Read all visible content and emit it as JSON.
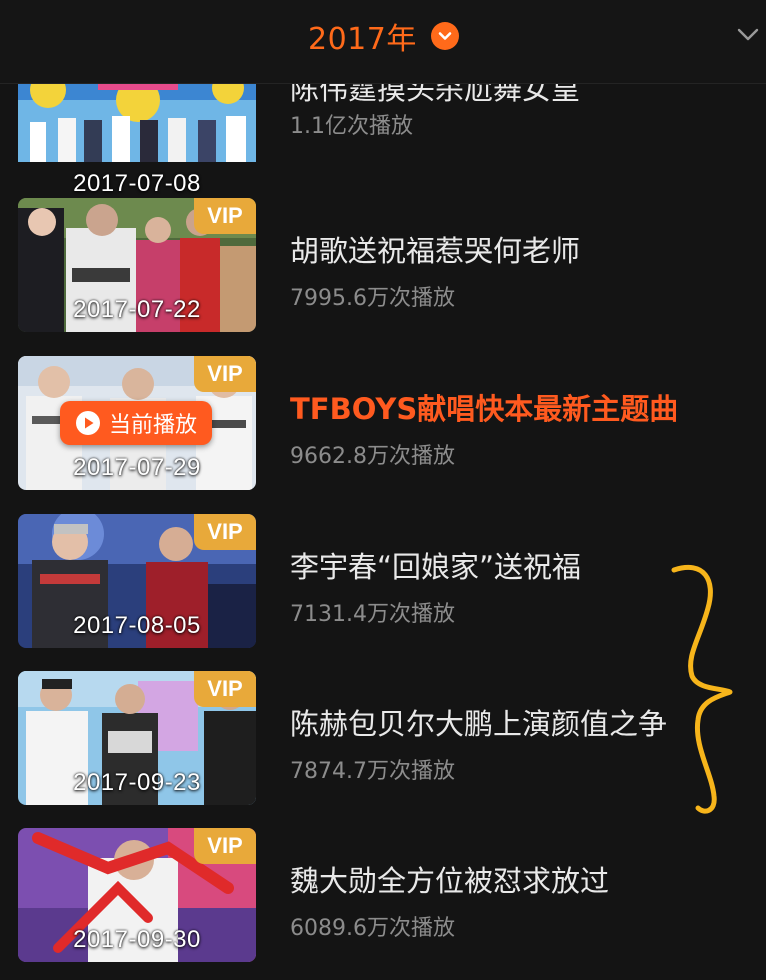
{
  "header": {
    "year_label": "2017年",
    "year_dropdown_icon": "chevron-down-icon",
    "collapse_icon": "chevron-down-icon"
  },
  "colors": {
    "accent": "#ff5a1f",
    "vip_badge": "#e8a93a",
    "annotation_brace": "#f7b51b",
    "background": "#141414",
    "secondary_text": "#8c8c8c"
  },
  "episodes": [
    {
      "title": "陈伟霆摸头杀尬舞女皇",
      "plays": "1.1亿次播放",
      "date": "2017-07-08",
      "vip": false,
      "playing": false
    },
    {
      "title": "胡歌送祝福惹哭何老师",
      "plays": "7995.6万次播放",
      "date": "2017-07-22",
      "vip": true,
      "vip_label": "VIP",
      "playing": false
    },
    {
      "title": "TFBOYS献唱快本最新主题曲",
      "plays": "9662.8万次播放",
      "date": "2017-07-29",
      "vip": true,
      "vip_label": "VIP",
      "playing": true,
      "now_playing_label": "当前播放"
    },
    {
      "title": "李宇春“回娘家”送祝福",
      "plays": "7131.4万次播放",
      "date": "2017-08-05",
      "vip": true,
      "vip_label": "VIP",
      "playing": false
    },
    {
      "title": "陈赫包贝尔大鹏上演颜值之争",
      "plays": "7874.7万次播放",
      "date": "2017-09-23",
      "vip": true,
      "vip_label": "VIP",
      "playing": false
    },
    {
      "title": "魏大勋全方位被怼求放过",
      "plays": "6089.6万次播放",
      "date": "2017-09-30",
      "vip": true,
      "vip_label": "VIP",
      "playing": false
    }
  ]
}
